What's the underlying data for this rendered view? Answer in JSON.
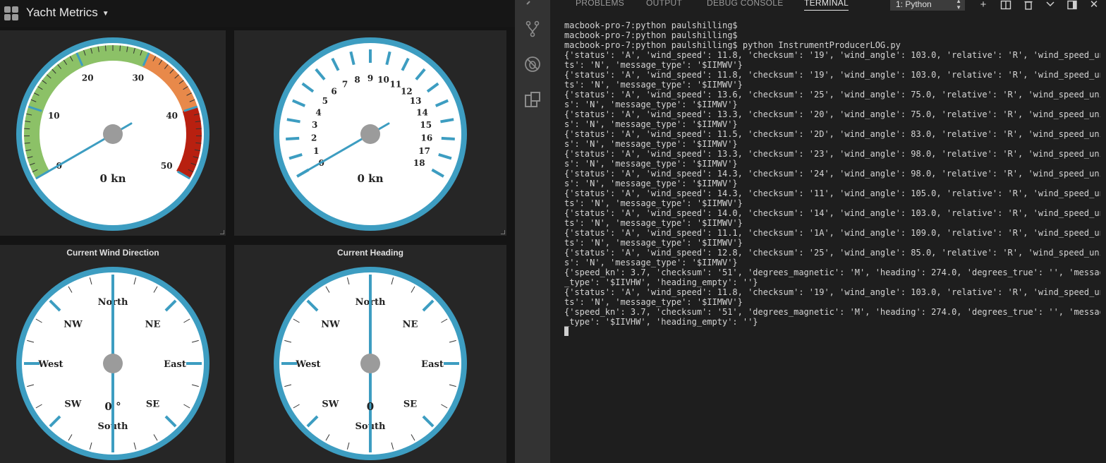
{
  "dashboard": {
    "title": "Yacht Metrics",
    "panels": {
      "speed": {
        "unit_label": "0 kn",
        "value": 0,
        "min": 0,
        "max": 50,
        "tick_labels": [
          "0",
          "10",
          "20",
          "30",
          "40",
          "50"
        ],
        "bands": [
          {
            "from": 0,
            "to": 30,
            "color": "#8cc167"
          },
          {
            "from": 30,
            "to": 40,
            "color": "#e8894a"
          },
          {
            "from": 40,
            "to": 50,
            "color": "#b82010"
          }
        ]
      },
      "speed2": {
        "unit_label": "0 kn",
        "value": 0,
        "min": 0,
        "max": 18,
        "tick_labels": [
          "0",
          "1",
          "2",
          "3",
          "4",
          "5",
          "6",
          "7",
          "8",
          "9",
          "10",
          "11",
          "12",
          "13",
          "14",
          "15",
          "16",
          "17",
          "18"
        ]
      },
      "wind_direction": {
        "title": "Current Wind Direction",
        "value_label": "0 °",
        "value": 0,
        "labels": [
          "North",
          "NE",
          "East",
          "SE",
          "South",
          "SW",
          "West",
          "NW"
        ]
      },
      "heading": {
        "title": "Current Heading",
        "value_label": "0",
        "value": 0,
        "labels": [
          "North",
          "NE",
          "East",
          "SE",
          "South",
          "SW",
          "West",
          "NW"
        ]
      }
    },
    "colors": {
      "accent": "#3d9dc1",
      "hub": "#9b9b9b"
    }
  },
  "vscode": {
    "tabs": [
      "PROBLEMS",
      "OUTPUT",
      "DEBUG CONSOLE",
      "TERMINAL"
    ],
    "active_tab": "TERMINAL",
    "terminal_select": "1: Python",
    "terminal_lines": [
      "macbook-pro-7:python paulshilling$",
      "macbook-pro-7:python paulshilling$",
      "macbook-pro-7:python paulshilling$ python InstrumentProducerLOG.py",
      "{'status': 'A', 'wind_speed': 11.8, 'checksum': '19', 'wind_angle': 103.0, 'relative': 'R', 'wind_speed_uni",
      "ts': 'N', 'message_type': '$IIMWV'}",
      "{'status': 'A', 'wind_speed': 11.8, 'checksum': '19', 'wind_angle': 103.0, 'relative': 'R', 'wind_speed_uni",
      "ts': 'N', 'message_type': '$IIMWV'}",
      "{'status': 'A', 'wind_speed': 13.6, 'checksum': '25', 'wind_angle': 75.0, 'relative': 'R', 'wind_speed_unit",
      "s': 'N', 'message_type': '$IIMWV'}",
      "{'status': 'A', 'wind_speed': 13.3, 'checksum': '20', 'wind_angle': 75.0, 'relative': 'R', 'wind_speed_unit",
      "s': 'N', 'message_type': '$IIMWV'}",
      "{'status': 'A', 'wind_speed': 11.5, 'checksum': '2D', 'wind_angle': 83.0, 'relative': 'R', 'wind_speed_unit",
      "s': 'N', 'message_type': '$IIMWV'}",
      "{'status': 'A', 'wind_speed': 13.3, 'checksum': '23', 'wind_angle': 98.0, 'relative': 'R', 'wind_speed_unit",
      "s': 'N', 'message_type': '$IIMWV'}",
      "{'status': 'A', 'wind_speed': 14.3, 'checksum': '24', 'wind_angle': 98.0, 'relative': 'R', 'wind_speed_unit",
      "s': 'N', 'message_type': '$IIMWV'}",
      "{'status': 'A', 'wind_speed': 14.3, 'checksum': '11', 'wind_angle': 105.0, 'relative': 'R', 'wind_speed_uni",
      "ts': 'N', 'message_type': '$IIMWV'}",
      "{'status': 'A', 'wind_speed': 14.0, 'checksum': '14', 'wind_angle': 103.0, 'relative': 'R', 'wind_speed_uni",
      "ts': 'N', 'message_type': '$IIMWV'}",
      "{'status': 'A', 'wind_speed': 11.1, 'checksum': '1A', 'wind_angle': 109.0, 'relative': 'R', 'wind_speed_uni",
      "ts': 'N', 'message_type': '$IIMWV'}",
      "{'status': 'A', 'wind_speed': 12.8, 'checksum': '25', 'wind_angle': 85.0, 'relative': 'R', 'wind_speed_unit",
      "s': 'N', 'message_type': '$IIMWV'}",
      "{'speed_kn': 3.7, 'checksum': '51', 'degrees_magnetic': 'M', 'heading': 274.0, 'degrees_true': '', 'message",
      "_type': '$IIVHW', 'heading_empty': ''}",
      "{'status': 'A', 'wind_speed': 11.8, 'checksum': '19', 'wind_angle': 103.0, 'relative': 'R', 'wind_speed_uni",
      "ts': 'N', 'message_type': '$IIMWV'}",
      "{'speed_kn': 3.7, 'checksum': '51', 'degrees_magnetic': 'M', 'heading': 274.0, 'degrees_true': '', 'message",
      "_type': '$IIVHW', 'heading_empty': ''}"
    ]
  }
}
